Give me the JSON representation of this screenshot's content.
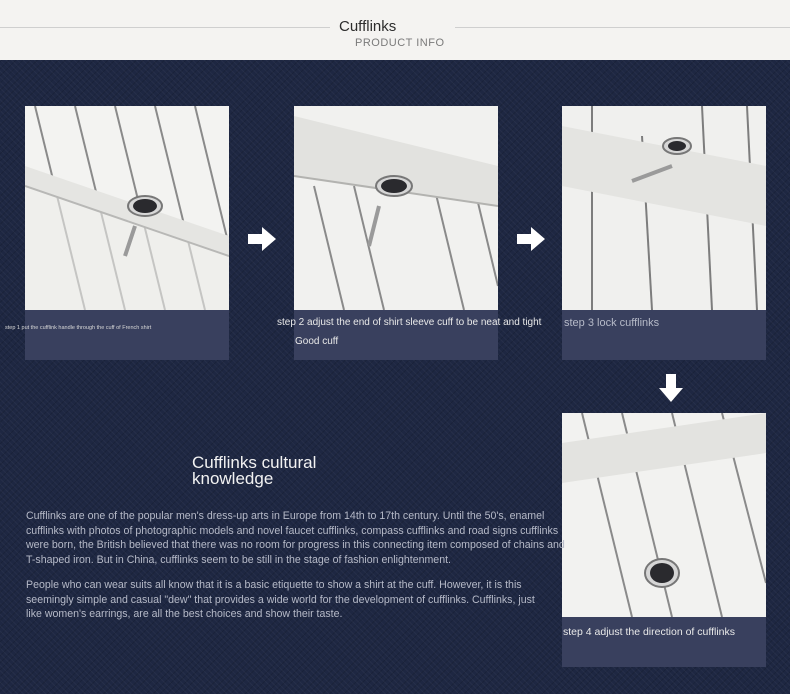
{
  "header": {
    "title": "Cufflinks",
    "subtitle": "PRODUCT INFO"
  },
  "steps": [
    {
      "caption": "step 1 put the cufflink handle through the cuff of French shirt",
      "image": "shirt-cuff-cufflink-step1"
    },
    {
      "caption": "step 2 adjust the end of shirt sleeve cuff to be neat and tight",
      "caption_extra": "Good cuff",
      "image": "shirt-cuff-cufflink-step2"
    },
    {
      "caption": "step 3 lock cufflinks",
      "image": "shirt-cuff-cufflink-step3"
    },
    {
      "caption": "step 4 adjust the direction of cufflinks",
      "image": "shirt-cuff-cufflink-step4"
    }
  ],
  "arrows": [
    "arrow-right-icon",
    "arrow-right-icon",
    "arrow-down-icon"
  ],
  "knowledge": {
    "title": "Cufflinks cultural knowledge",
    "paragraph1": "Cufflinks are one of the popular men's dress-up arts in Europe from 14th to 17th century. Until the 50's, enamel cufflinks with photos of photographic models and novel faucet cufflinks, compass cufflinks and road signs cufflinks were born, the British believed that there was no room for progress in this connecting item composed of chains and T-shaped iron. But in China, cufflinks seem to be still in the stage of fashion enlightenment.",
    "paragraph2": "People who can wear suits all know that it is a basic etiquette to show a shirt at the cuff. However, it is this seemingly simple and casual \"dew\" that provides a wide world for the development of cufflinks. Cufflinks, just like women's earrings, are all the best choices and show their taste."
  },
  "colors": {
    "background": "#1e2742",
    "caption_box": "#39405e",
    "header_bg": "#f4f3f1"
  }
}
